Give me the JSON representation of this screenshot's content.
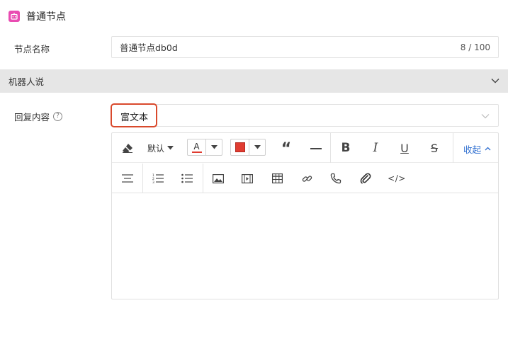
{
  "header": {
    "title": "普通节点",
    "icon": "robot-icon",
    "icon_color": "#e94cb2"
  },
  "node_name": {
    "label": "节点名称",
    "value": "普通节点db0d",
    "count": "8 / 100"
  },
  "section": {
    "title": "机器人说"
  },
  "reply": {
    "label": "回复内容",
    "help_glyph": "?",
    "selected": "富文本"
  },
  "toolbar": {
    "font_default": "默认",
    "font_color_glyph": "A",
    "font_color": "#e03c31",
    "bg_color": "#e03c31",
    "collapse_label": "收起",
    "bold_glyph": "B",
    "italic_glyph": "I",
    "underline_glyph": "U",
    "strike_glyph": "S",
    "quote_glyph": "“",
    "code_glyph": "</>"
  },
  "colors": {
    "accent": "#2f6fd0",
    "highlight": "#d9492c"
  }
}
